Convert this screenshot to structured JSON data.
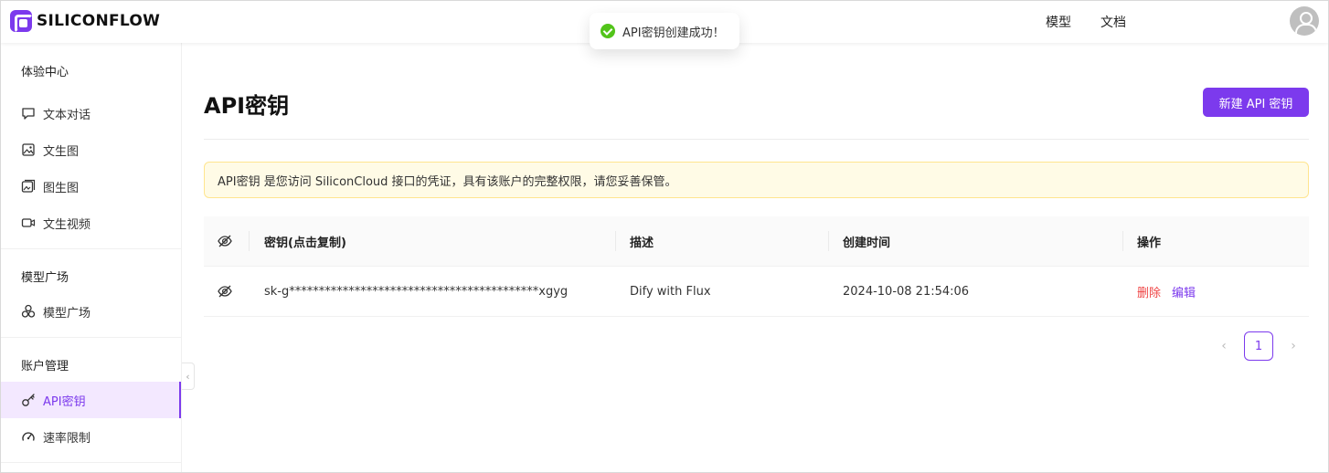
{
  "header": {
    "logo_text": "SILICONFLOW",
    "nav": {
      "models": "模型",
      "docs": "文档"
    }
  },
  "toast": {
    "message": "API密钥创建成功！"
  },
  "sidebar": {
    "sections": [
      {
        "title": "体验中心"
      },
      {
        "title": "模型广场"
      },
      {
        "title": "账户管理"
      }
    ],
    "items": [
      {
        "label": "文本对话",
        "icon": "chat-icon"
      },
      {
        "label": "文生图",
        "icon": "image-icon"
      },
      {
        "label": "图生图",
        "icon": "image-to-image-icon"
      },
      {
        "label": "文生视频",
        "icon": "video-icon"
      },
      {
        "label": "模型广场",
        "icon": "models-icon"
      },
      {
        "label": "API密钥",
        "icon": "key-icon"
      },
      {
        "label": "速率限制",
        "icon": "gauge-icon"
      }
    ],
    "active_item": "API密钥"
  },
  "main": {
    "title": "API密钥",
    "new_key_button": "新建 API 密钥",
    "notice": "API密钥 是您访问 SiliconCloud 接口的凭证，具有该账户的完整权限，请您妥善保管。",
    "table": {
      "headers": [
        "密钥(点击复制)",
        "描述",
        "创建时间",
        "操作"
      ],
      "rows": [
        {
          "key": "sk-g******************************************xgyg",
          "description": "Dify with Flux",
          "created": "2024-10-08 21:54:06",
          "delete": "删除",
          "edit": "编辑"
        }
      ]
    },
    "pagination": {
      "current": "1",
      "prev": "‹",
      "next": "›"
    }
  },
  "colors": {
    "accent": "#7c3aed",
    "danger": "#ef4444",
    "success": "#52c41a",
    "notice_bg": "#fffbe6"
  }
}
